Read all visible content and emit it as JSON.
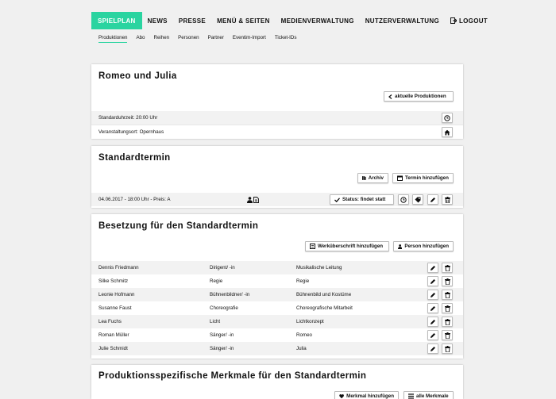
{
  "nav": {
    "items": [
      "SPIELPLAN",
      "NEWS",
      "PRESSE",
      "MENÜ & SEITEN",
      "MEDIENVERWALTUNG",
      "NUTZERVERWALTUNG"
    ],
    "logout": "LOGOUT",
    "accent": "#2ad4a0"
  },
  "subnav": [
    "Produktionen",
    "Abo",
    "Reihen",
    "Personen",
    "Partner",
    "Eventim-Import",
    "Ticket-IDs"
  ],
  "production": {
    "title": "Romeo und Julia",
    "back_button": "aktuelle Produktionen",
    "standard_time": "Standarduhrzeit: 20:00 Uhr",
    "venue": "Veranstaltungsort: Opernhaus"
  },
  "standardtermin": {
    "title": "Standardtermin",
    "archive_button": "Archiv",
    "add_button": "Termin hinzufügen",
    "date_row": "04.06.2017 - 18:00 Uhr - Preis: A",
    "status_button": "Status: findet statt"
  },
  "cast": {
    "title": "Besetzung für den Standardtermin",
    "add_heading_button": "Werküberschrift hinzufügen",
    "add_person_button": "Person hinzufügen",
    "rows": [
      {
        "name": "Dennis Friedmann",
        "role": "Dirigent/ -in",
        "function": "Musikalische Leitung"
      },
      {
        "name": "Silke Schmitz",
        "role": "Regie",
        "function": "Regie"
      },
      {
        "name": "Leonie Hofmann",
        "role": "Bühnenbildner/ -in",
        "function": "Bühnenbild und Kostüme"
      },
      {
        "name": "Susanne Faust",
        "role": "Choreografie",
        "function": "Choreografische Mitarbeit"
      },
      {
        "name": "Lea Fuchs",
        "role": "Licht",
        "function": "Lichtkonzept"
      },
      {
        "name": "Roman Müller",
        "role": "Sänger/ -in",
        "function": "Romeo"
      },
      {
        "name": "Julie Schmidt",
        "role": "Sänger/ -in",
        "function": "Julia"
      }
    ]
  },
  "features": {
    "title": "Produktionsspezifische Merkmale für den Standardtermin",
    "add_button": "Merkmal hinzufügen",
    "all_button": "alle Merkmale"
  }
}
